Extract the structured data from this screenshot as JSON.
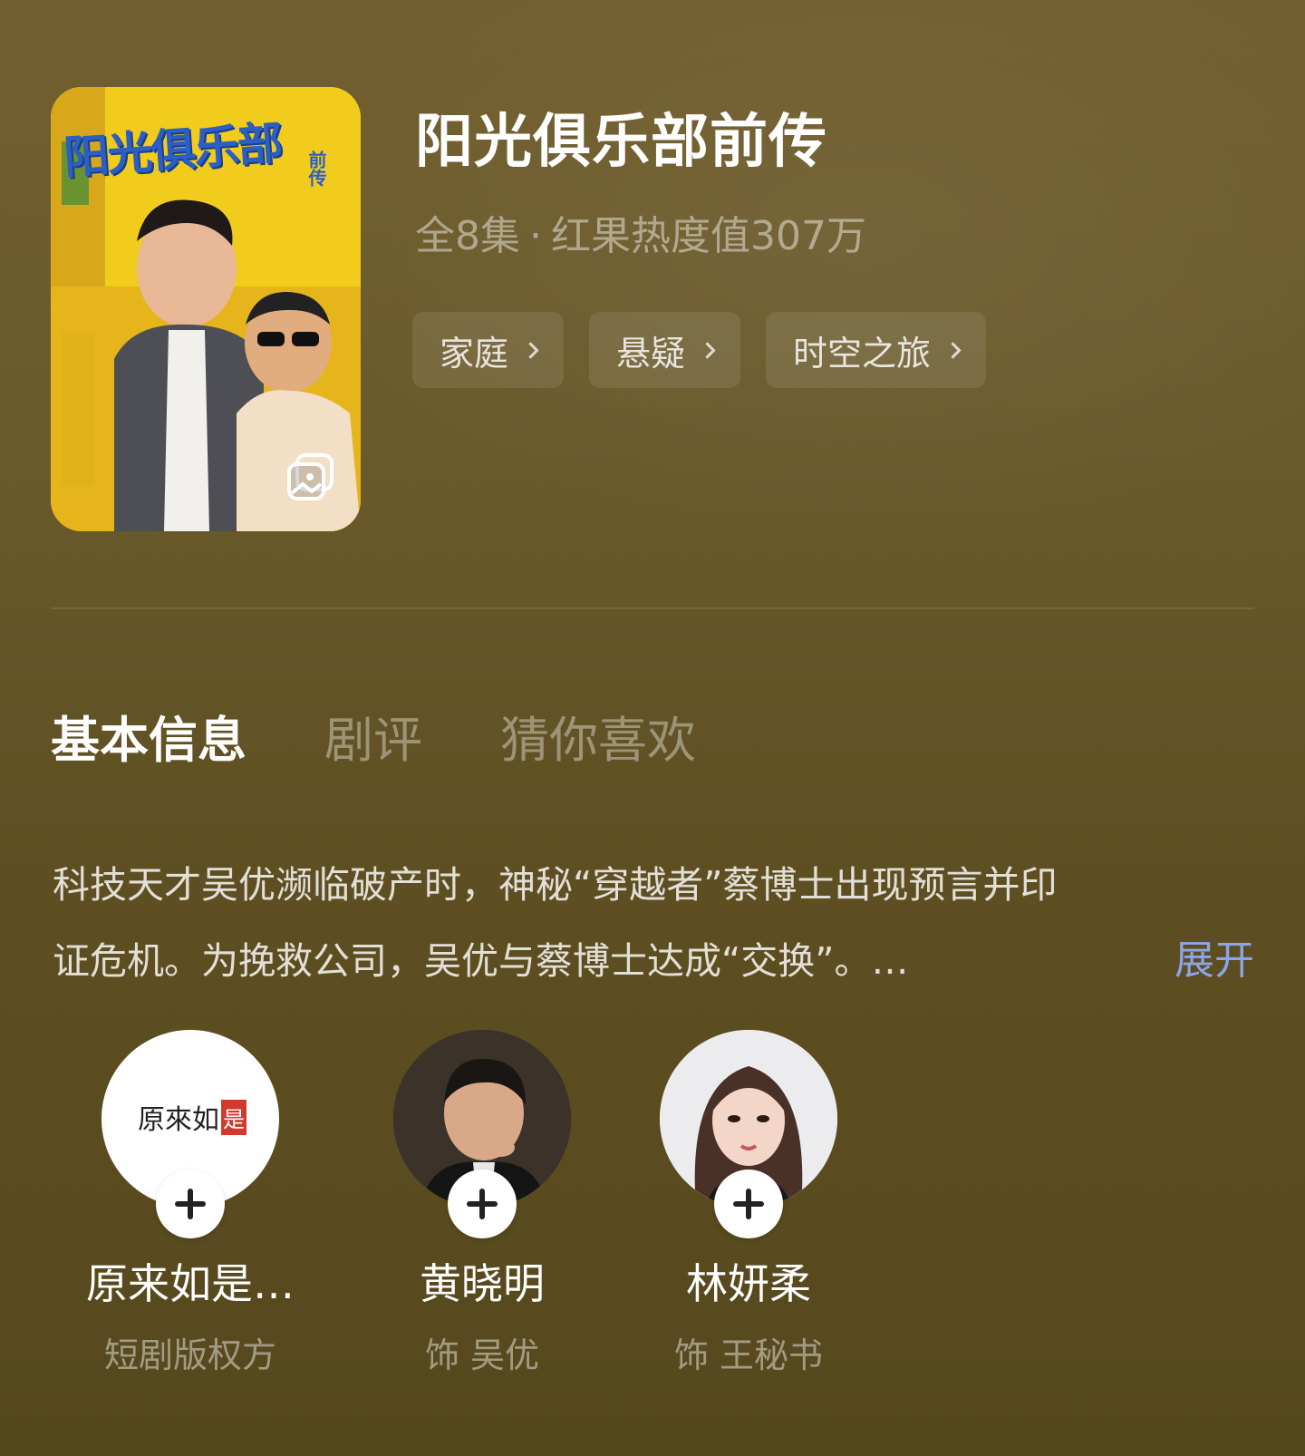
{
  "show": {
    "title": "阳光俱乐部前传",
    "episodes": "全8集",
    "separator": "·",
    "heat": "红果热度值307万"
  },
  "poster": {
    "title_art": "阳光俱乐部",
    "subtitle_art": "前传",
    "gallery_icon": "gallery-icon"
  },
  "tags": [
    {
      "label": "家庭"
    },
    {
      "label": "悬疑"
    },
    {
      "label": "时空之旅"
    }
  ],
  "tabs": [
    {
      "label": "基本信息",
      "active": true
    },
    {
      "label": "剧评",
      "active": false
    },
    {
      "label": "猜你喜欢",
      "active": false
    }
  ],
  "description": {
    "line1": "科技天才吴优濒临破产时，神秘“穿越者”蔡博士出现预言并印",
    "line2": "证危机。为挽救公司，吴优与蔡博士达成“交换”。…",
    "expand_label": "展开"
  },
  "cast": [
    {
      "name": "原来如是…",
      "role": "短剧版权方",
      "logo_text": "原來如",
      "logo_seal": "是"
    },
    {
      "name": "黄晓明",
      "role": "饰 吴优"
    },
    {
      "name": "林妍柔",
      "role": "饰 王秘书"
    }
  ],
  "colors": {
    "background": "#6a5a2c",
    "expand_link": "#8aa6e8",
    "poster_yellow": "#f5d31f",
    "poster_title_blue": "#2b5fc4"
  }
}
